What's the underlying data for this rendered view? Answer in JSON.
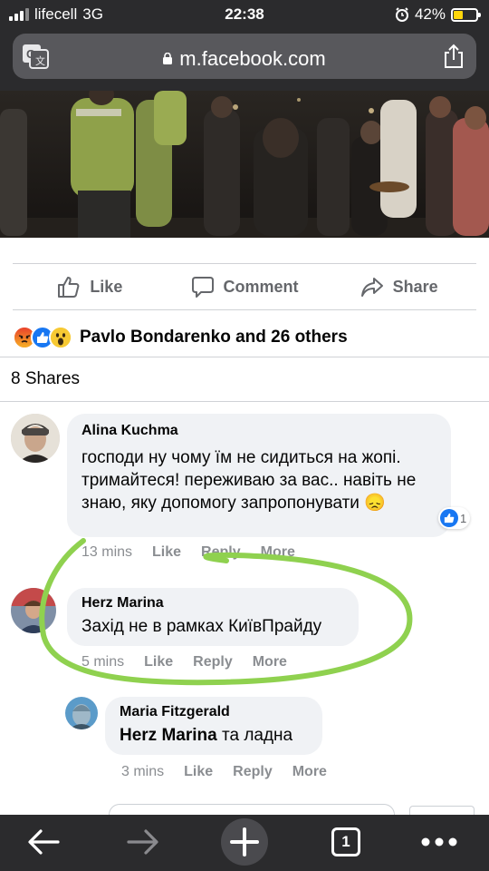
{
  "status_bar": {
    "carrier": "lifecell",
    "network": "3G",
    "time": "22:38",
    "battery_percent": "42%",
    "battery_level": 0.42,
    "alarm_icon": "alarm-clock-icon"
  },
  "browser": {
    "url": "m.facebook.com",
    "translate_icon": "translate-icon",
    "share_icon": "share-icon"
  },
  "post_actions": {
    "like": "Like",
    "comment": "Comment",
    "share": "Share"
  },
  "reactions": {
    "icons": [
      "angry-reaction-icon",
      "like-reaction-icon",
      "wow-reaction-icon"
    ],
    "summary": "Pavlo Bondarenko and 26 others"
  },
  "shares_count": "8 Shares",
  "comments": [
    {
      "author": "Alina Kuchma",
      "text": "господи ну чому їм не сидиться на жопі. тримайтеся! переживаю за вас.. навіть не знаю, яку допомогу запропонувати 😞",
      "time": "13 mins",
      "like": "Like",
      "reply": "Reply",
      "more": "More",
      "reaction_count": "1"
    },
    {
      "author": "Herz Marina",
      "text": "Захід не в рамках КиївПрайду",
      "time": "5 mins",
      "like": "Like",
      "reply": "Reply",
      "more": "More"
    },
    {
      "author": "Maria Fitzgerald",
      "mention": "Herz Marina",
      "text": "та ладна",
      "time": "3 mins",
      "like": "Like",
      "reply": "Reply",
      "more": "More"
    }
  ],
  "toolbar": {
    "tab_count": "1"
  },
  "colors": {
    "facebook_blue": "#1877f2",
    "annotation_green": "#8fd14f",
    "chrome_dark": "#2b2b2d"
  }
}
